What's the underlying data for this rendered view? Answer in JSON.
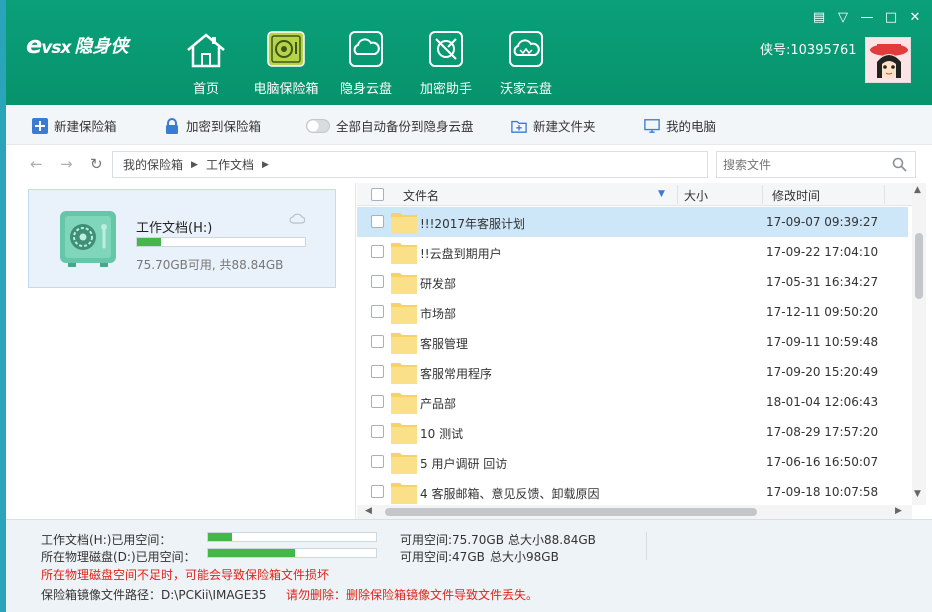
{
  "header": {
    "logo_mark": "vsx",
    "logo_text": "隐身侠",
    "nav": [
      {
        "label": "首页",
        "icon": "home-icon"
      },
      {
        "label": "电脑保险箱",
        "icon": "safe-icon",
        "active": true
      },
      {
        "label": "隐身云盘",
        "icon": "cloud-icon"
      },
      {
        "label": "加密助手",
        "icon": "encrypt-tool-icon"
      },
      {
        "label": "沃家云盘",
        "icon": "wo-cloud-icon"
      }
    ],
    "account": "侠号:10395761"
  },
  "toolbar": {
    "new_vault": "新建保险箱",
    "encrypt_to_vault": "加密到保险箱",
    "auto_backup": "全部自动备份到隐身云盘",
    "new_folder": "新建文件夹",
    "my_computer": "我的电脑"
  },
  "address": {
    "crumbs": [
      "我的保险箱",
      "工作文档"
    ],
    "search_placeholder": "搜索文件"
  },
  "vault": {
    "name": "工作文档(H:)",
    "usage_fraction": 0.14,
    "space": "75.70GB可用, 共88.84GB"
  },
  "file_list": {
    "columns": {
      "name": "文件名",
      "size": "大小",
      "modified": "修改时间"
    },
    "rows": [
      {
        "name": "!!!2017年客服计划",
        "modified": "17-09-07 09:39:27",
        "selected": true
      },
      {
        "name": "!!云盘到期用户",
        "modified": "17-09-22 17:04:10"
      },
      {
        "name": "研发部",
        "modified": "17-05-31 16:34:27"
      },
      {
        "name": "市场部",
        "modified": "17-12-11 09:50:20"
      },
      {
        "name": "客服管理",
        "modified": "17-09-11 10:59:48"
      },
      {
        "name": "客服常用程序",
        "modified": "17-09-20 15:20:49"
      },
      {
        "name": "产品部",
        "modified": "18-01-04 12:06:43"
      },
      {
        "name": "10 测试",
        "modified": "17-08-29 17:57:20"
      },
      {
        "name": "5 用户调研 回访",
        "modified": "17-06-16 16:50:07"
      },
      {
        "name": "4 客服邮箱、意见反馈、卸载原因",
        "modified": "17-09-18 10:07:58"
      }
    ]
  },
  "footer": {
    "h_used_label": "工作文档(H:)已用空间：",
    "h_used_fraction": 0.14,
    "h_available": "可用空间:75.70GB",
    "h_total": "总大小88.84GB",
    "d_used_label": "所在物理磁盘(D:)已用空间：",
    "d_used_fraction": 0.52,
    "d_available": "可用空间:47GB",
    "d_total": "总大小98GB",
    "warning": "所在物理磁盘空间不足时，可能会导致保险箱文件损坏",
    "image_path": "保险箱镜像文件路径：D:\\PCKii\\IMAGE35",
    "delete_warning": "请勿删除：删除保险箱镜像文件导致文件丢失。"
  },
  "colors": {
    "header_bg": "#0aa07a",
    "accent_green": "#45b64a",
    "warning": "#e2231a",
    "selected_row": "#cde6f8"
  }
}
